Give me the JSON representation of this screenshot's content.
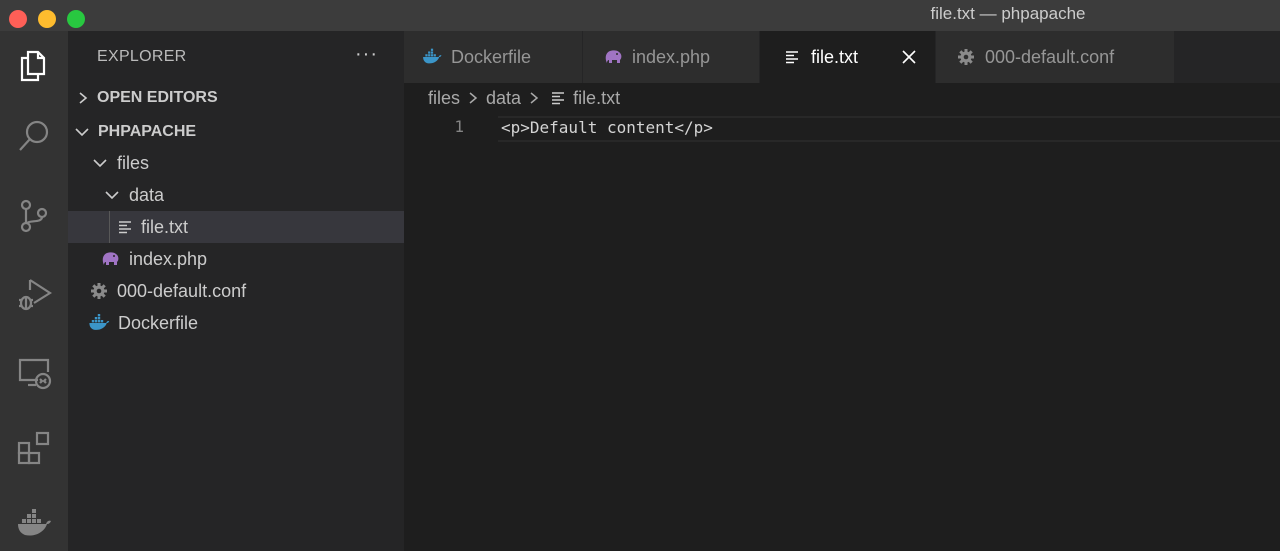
{
  "window": {
    "title": "file.txt — phpapache"
  },
  "activity_bar": {
    "items": [
      "explorer-icon",
      "search-icon",
      "source-control-icon",
      "run-debug-icon",
      "remote-explorer-icon",
      "extensions-icon",
      "docker-icon"
    ]
  },
  "sidebar": {
    "title": "EXPLORER",
    "more": "···",
    "open_editors_label": "OPEN EDITORS",
    "project_label": "PHPAPACHE",
    "tree": [
      {
        "label": "files",
        "type": "folder"
      },
      {
        "label": "data",
        "type": "folder"
      },
      {
        "label": "file.txt",
        "type": "text-file",
        "selected": true
      },
      {
        "label": "index.php",
        "type": "php-file"
      },
      {
        "label": "000-default.conf",
        "type": "config-file"
      },
      {
        "label": "Dockerfile",
        "type": "docker-file"
      }
    ]
  },
  "tabs": [
    {
      "label": "Dockerfile",
      "icon": "docker-icon",
      "active": false
    },
    {
      "label": "index.php",
      "icon": "php-icon",
      "active": false
    },
    {
      "label": "file.txt",
      "icon": "text-file-icon",
      "active": true
    },
    {
      "label": "000-default.conf",
      "icon": "gear-icon",
      "active": false
    }
  ],
  "breadcrumb": [
    "files",
    "data",
    "file.txt"
  ],
  "editor": {
    "lines": [
      {
        "number": "1",
        "text": "<p>Default content</p>"
      }
    ]
  },
  "colors": {
    "titlebar": "#3c3c3c",
    "activity_bar": "#333333",
    "sidebar": "#252526",
    "editor": "#1e1e1e",
    "selection": "#37373d",
    "docker_blue": "#3b95c8",
    "php_purple": "#a074c4"
  }
}
